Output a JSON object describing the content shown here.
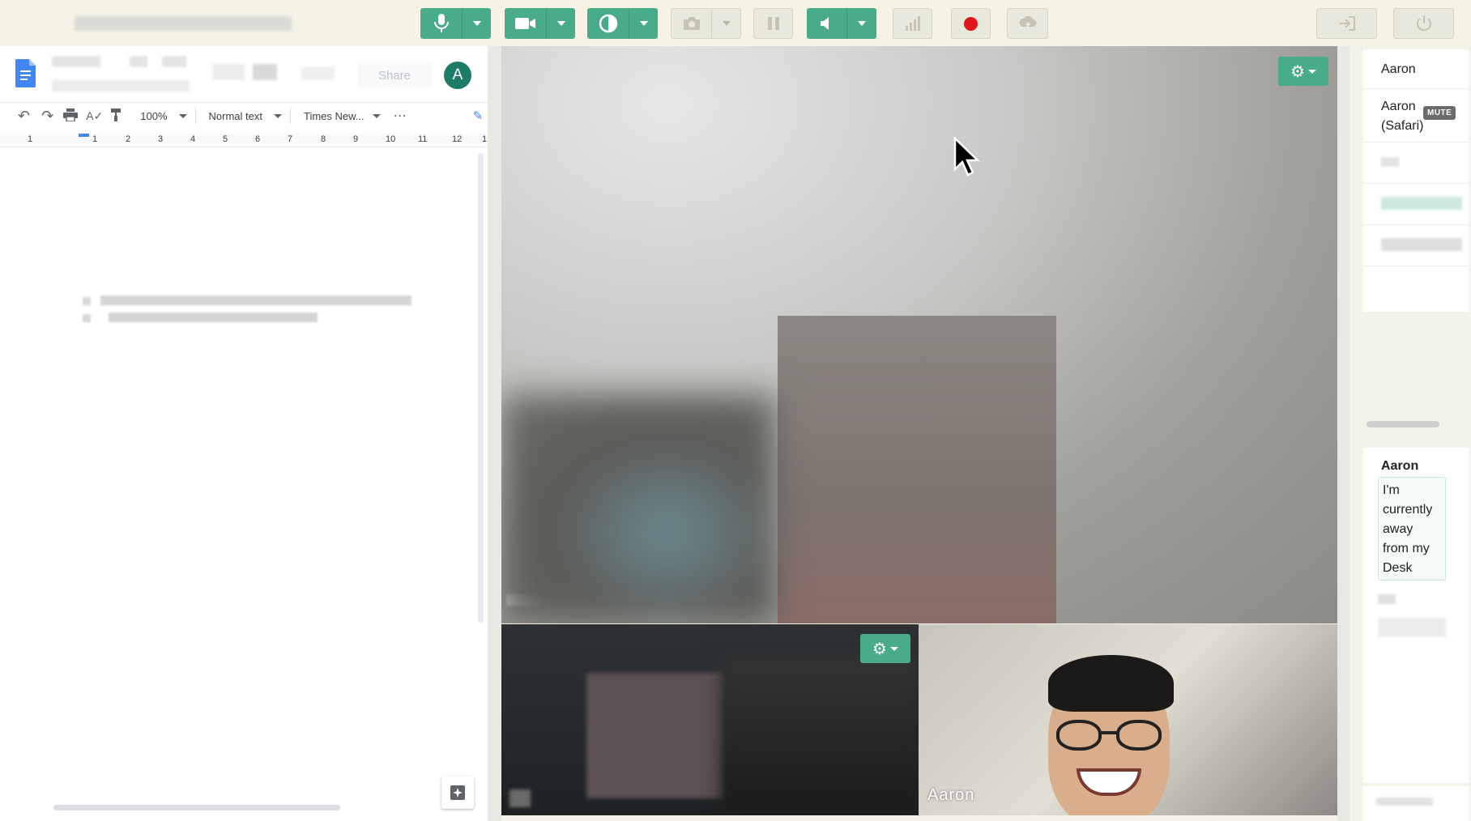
{
  "toolbar": {
    "buttons": [
      {
        "name": "mic",
        "style": "green",
        "has_dropdown": true
      },
      {
        "name": "camera",
        "style": "green",
        "has_dropdown": true
      },
      {
        "name": "contrast",
        "style": "green",
        "has_dropdown": true
      },
      {
        "name": "snapshot",
        "style": "grey",
        "has_dropdown": true
      },
      {
        "name": "pause",
        "style": "grey",
        "has_dropdown": false
      },
      {
        "name": "speaker",
        "style": "green",
        "has_dropdown": true
      },
      {
        "name": "stats",
        "style": "grey",
        "has_dropdown": false
      },
      {
        "name": "record",
        "style": "grey",
        "has_dropdown": false
      },
      {
        "name": "screen-share",
        "style": "grey",
        "has_dropdown": false
      },
      {
        "name": "exit",
        "style": "grey",
        "has_dropdown": false
      },
      {
        "name": "power",
        "style": "grey",
        "has_dropdown": false
      }
    ],
    "accent_color": "#4aab8b",
    "record_color": "#e0181b"
  },
  "docs": {
    "share_label": "Share",
    "avatar_letter": "A",
    "zoom": "100%",
    "style": "Normal text",
    "font": "Times New...",
    "more": "⋯",
    "ruler_ticks": [
      "1",
      "1",
      "2",
      "3",
      "4",
      "5",
      "6",
      "7",
      "8",
      "9",
      "10",
      "11",
      "12",
      "1"
    ]
  },
  "video": {
    "main_label": "",
    "bottom_right_label": "Aaron"
  },
  "sidebar": {
    "participants": [
      {
        "name": "Aaron"
      },
      {
        "name": "Aaron (Safari)",
        "badge": "MUTE"
      }
    ],
    "chat": {
      "sender": "Aaron",
      "message": "I'm currently away from my Desk"
    }
  }
}
